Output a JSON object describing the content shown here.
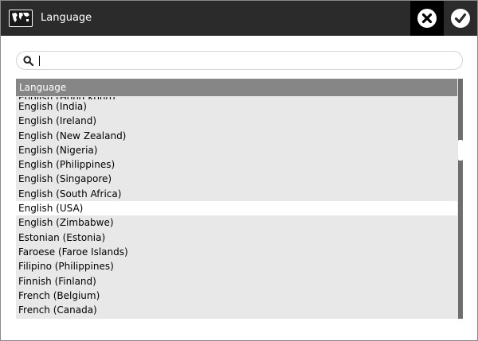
{
  "titlebar": {
    "title": "Language",
    "app_icon": "world-map-icon",
    "cancel_icon": "close-circle-icon",
    "confirm_icon": "check-circle-icon"
  },
  "search": {
    "value": "",
    "placeholder": ""
  },
  "list": {
    "header": "Language",
    "selected": "English (USA)",
    "items": [
      "English (Hong Kong)",
      "English (India)",
      "English (Ireland)",
      "English (New Zealand)",
      "English (Nigeria)",
      "English (Philippines)",
      "English (Singapore)",
      "English (South Africa)",
      "English (USA)",
      "English (Zimbabwe)",
      "Estonian (Estonia)",
      "Faroese (Faroe Islands)",
      "Filipino (Philippines)",
      "Finnish (Finland)",
      "French (Belgium)",
      "French (Canada)"
    ]
  },
  "colors": {
    "titlebar": "#2b2b2b",
    "header": "#868686",
    "row": "#e8e8e8",
    "selected_row": "#ffffff"
  }
}
